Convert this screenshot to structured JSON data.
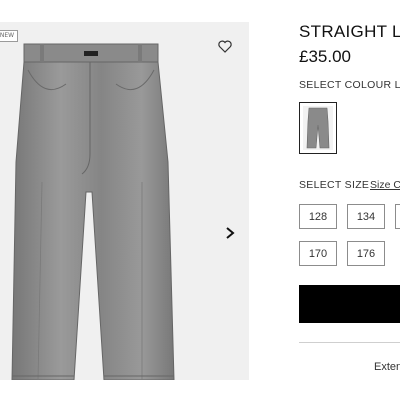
{
  "product": {
    "title": "STRAIGHT LE",
    "price": "£35.00",
    "badge": "NEW"
  },
  "colour": {
    "label": "SELECT COLOUR LIG",
    "swatch_icon": "jeans-thumbnail"
  },
  "size": {
    "label": "SELECT SIZE",
    "guide_link": "Size C",
    "options": [
      "128",
      "134",
      "",
      "170",
      "176"
    ]
  },
  "actions": {
    "add_to_bag_label": "",
    "extend_text": "Extend"
  },
  "gallery": {
    "image": "grey-straight-leg-jeans",
    "next_icon": "chevron-right-icon",
    "wishlist_icon": "heart-icon"
  },
  "colors": {
    "denim": "#8c8c8c",
    "accent": "#000000",
    "gallery_bg": "#f0f0f0"
  }
}
